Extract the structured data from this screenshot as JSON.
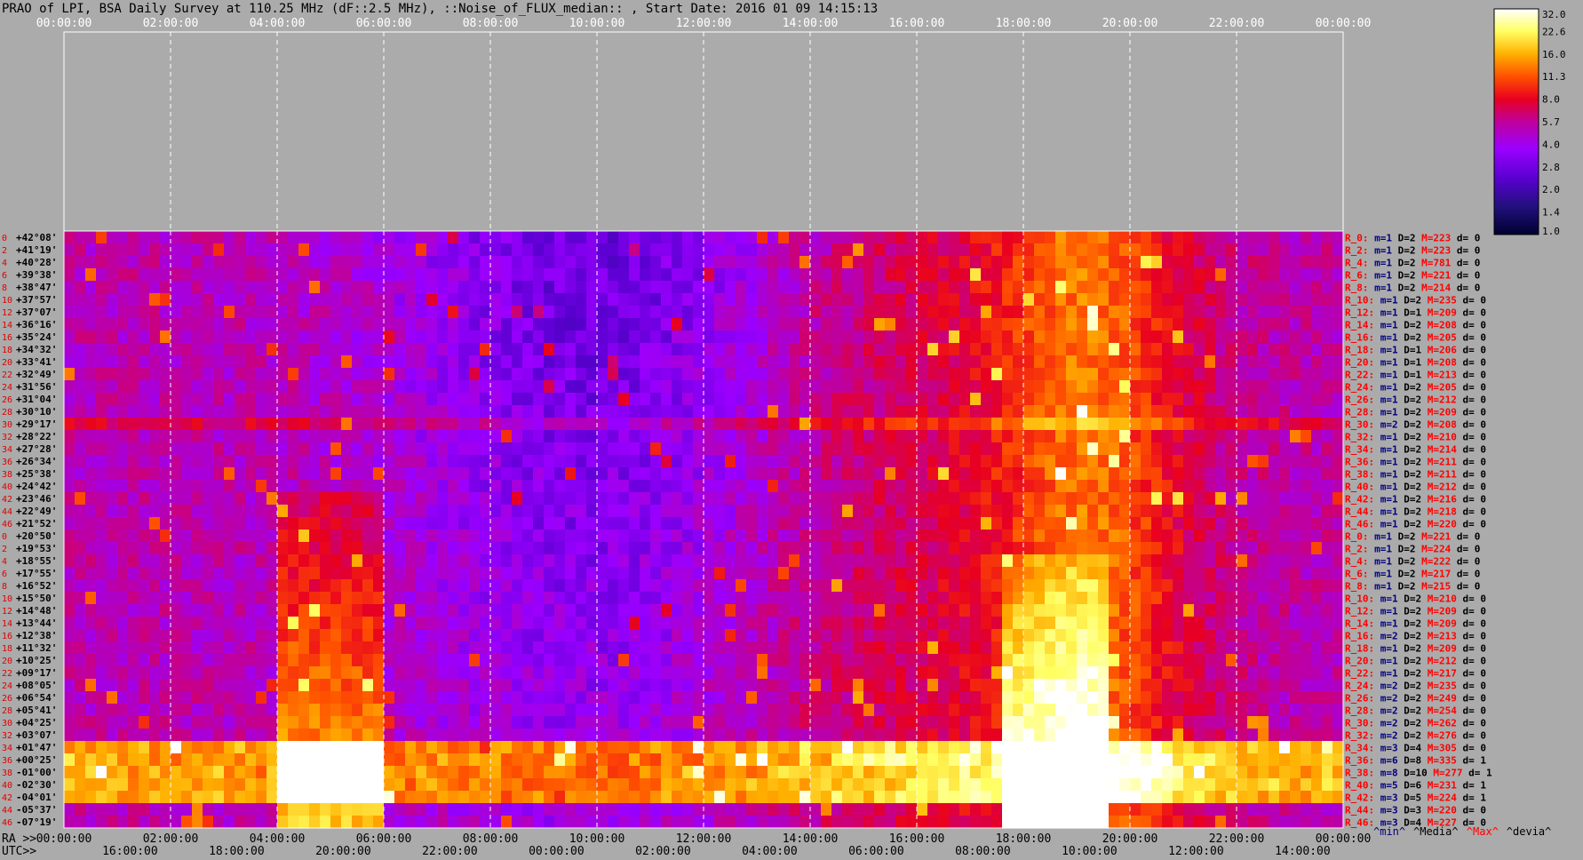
{
  "title": "PRAO of LPI, BSA Daily Survey at 110.25 MHz (dF::2.5 MHz), ::Noise_of_FLUX_median:: , Start Date: 2016 01 09 14:15:13",
  "chart_data": {
    "type": "heatmap",
    "title": "PRAO of LPI, BSA Daily Survey at 110.25 MHz (dF::2.5 MHz), ::Noise_of_FLUX_median:: , Start Date: 2016 01 09 14:15:13",
    "x_axis_top_ticks": [
      "00:00:00",
      "02:00:00",
      "04:00:00",
      "06:00:00",
      "08:00:00",
      "10:00:00",
      "12:00:00",
      "14:00:00",
      "16:00:00",
      "18:00:00",
      "20:00:00",
      "22:00:00",
      "00:00:00"
    ],
    "ra_axis_label": "RA >>",
    "ra_ticks": [
      "00:00:00",
      "02:00:00",
      "04:00:00",
      "06:00:00",
      "08:00:00",
      "10:00:00",
      "12:00:00",
      "14:00:00",
      "16:00:00",
      "18:00:00",
      "20:00:00",
      "22:00:00",
      "00:00:00"
    ],
    "utc_axis_label": "UTC>>",
    "utc_ticks": [
      "16:00:00",
      "18:00:00",
      "20:00:00",
      "22:00:00",
      "00:00:00",
      "02:00:00",
      "04:00:00",
      "06:00:00",
      "08:00:00",
      "10:00:00",
      "12:00:00",
      "14:00:00"
    ],
    "declination_labels": [
      "+42°08'",
      "+41°19'",
      "+40°28'",
      "+39°38'",
      "+38°47'",
      "+37°57'",
      "+37°07'",
      "+36°16'",
      "+35°24'",
      "+34°32'",
      "+33°41'",
      "+32°49'",
      "+31°56'",
      "+31°04'",
      "+30°10'",
      "+29°17'",
      "+28°22'",
      "+27°28'",
      "+26°34'",
      "+25°38'",
      "+24°42'",
      "+23°46'",
      "+22°49'",
      "+21°52'",
      "+20°50'",
      "+19°53'",
      "+18°55'",
      "+17°55'",
      "+16°52'",
      "+15°50'",
      "+14°48'",
      "+13°44'",
      "+12°38'",
      "+11°32'",
      "+10°25'",
      "+09°17'",
      "+08°05'",
      "+06°54'",
      "+05°41'",
      "+04°25'",
      "+03°07'",
      "+01°47'",
      "+00°25'",
      "-01°00'",
      "-02°30'",
      "-04°01'",
      "-05°37'",
      "-07°19'"
    ],
    "row_indices": [
      "0",
      "2",
      "4",
      "6",
      "8",
      "10",
      "12",
      "14",
      "16",
      "18",
      "20",
      "22",
      "24",
      "26",
      "28",
      "30",
      "32",
      "34",
      "36",
      "38",
      "40",
      "42",
      "44",
      "46",
      "0",
      "2",
      "4",
      "6",
      "8",
      "10",
      "12",
      "14",
      "16",
      "18",
      "20",
      "22",
      "24",
      "26",
      "28",
      "30",
      "32",
      "34",
      "36",
      "38",
      "40",
      "42",
      "44",
      "46"
    ],
    "colorbar": {
      "ticks": [
        "32.0",
        "22.6",
        "16.0",
        "11.3",
        "8.0",
        "5.7",
        "4.0",
        "2.8",
        "2.0",
        "1.4",
        "1.0"
      ],
      "scale": "log",
      "range": [
        1.0,
        32.0
      ],
      "colors": [
        "#ffffff",
        "#ffff60",
        "#ffb000",
        "#ff5000",
        "#e80020",
        "#c0009c",
        "#9a00ff",
        "#5a00d0",
        "#20107a",
        "#000030"
      ]
    },
    "row_stats": [
      {
        "r": "R_0:",
        "m": "m=1",
        "D": "D=2",
        "M": "M=223",
        "d": "d= 0"
      },
      {
        "r": "R_2:",
        "m": "m=1",
        "D": "D=2",
        "M": "M=223",
        "d": "d= 0"
      },
      {
        "r": "R_4:",
        "m": "m=1",
        "D": "D=2",
        "M": "M=781",
        "d": "d= 0"
      },
      {
        "r": "R_6:",
        "m": "m=1",
        "D": "D=2",
        "M": "M=221",
        "d": "d= 0"
      },
      {
        "r": "R_8:",
        "m": "m=1",
        "D": "D=2",
        "M": "M=214",
        "d": "d= 0"
      },
      {
        "r": "R_10:",
        "m": "m=1",
        "D": "D=2",
        "M": "M=235",
        "d": "d= 0"
      },
      {
        "r": "R_12:",
        "m": "m=1",
        "D": "D=1",
        "M": "M=209",
        "d": "d= 0"
      },
      {
        "r": "R_14:",
        "m": "m=1",
        "D": "D=2",
        "M": "M=208",
        "d": "d= 0"
      },
      {
        "r": "R_16:",
        "m": "m=1",
        "D": "D=2",
        "M": "M=205",
        "d": "d= 0"
      },
      {
        "r": "R_18:",
        "m": "m=1",
        "D": "D=1",
        "M": "M=206",
        "d": "d= 0"
      },
      {
        "r": "R_20:",
        "m": "m=1",
        "D": "D=1",
        "M": "M=208",
        "d": "d= 0"
      },
      {
        "r": "R_22:",
        "m": "m=1",
        "D": "D=1",
        "M": "M=213",
        "d": "d= 0"
      },
      {
        "r": "R_24:",
        "m": "m=1",
        "D": "D=2",
        "M": "M=205",
        "d": "d= 0"
      },
      {
        "r": "R_26:",
        "m": "m=1",
        "D": "D=2",
        "M": "M=212",
        "d": "d= 0"
      },
      {
        "r": "R_28:",
        "m": "m=1",
        "D": "D=2",
        "M": "M=209",
        "d": "d= 0"
      },
      {
        "r": "R_30:",
        "m": "m=2",
        "D": "D=2",
        "M": "M=208",
        "d": "d= 0"
      },
      {
        "r": "R_32:",
        "m": "m=1",
        "D": "D=2",
        "M": "M=210",
        "d": "d= 0"
      },
      {
        "r": "R_34:",
        "m": "m=1",
        "D": "D=2",
        "M": "M=214",
        "d": "d= 0"
      },
      {
        "r": "R_36:",
        "m": "m=1",
        "D": "D=2",
        "M": "M=211",
        "d": "d= 0"
      },
      {
        "r": "R_38:",
        "m": "m=1",
        "D": "D=2",
        "M": "M=211",
        "d": "d= 0"
      },
      {
        "r": "R_40:",
        "m": "m=1",
        "D": "D=2",
        "M": "M=212",
        "d": "d= 0"
      },
      {
        "r": "R_42:",
        "m": "m=1",
        "D": "D=2",
        "M": "M=216",
        "d": "d= 0"
      },
      {
        "r": "R_44:",
        "m": "m=1",
        "D": "D=2",
        "M": "M=218",
        "d": "d= 0"
      },
      {
        "r": "R_46:",
        "m": "m=1",
        "D": "D=2",
        "M": "M=220",
        "d": "d= 0"
      },
      {
        "r": "R_0:",
        "m": "m=1",
        "D": "D=2",
        "M": "M=221",
        "d": "d= 0"
      },
      {
        "r": "R_2:",
        "m": "m=1",
        "D": "D=2",
        "M": "M=224",
        "d": "d= 0"
      },
      {
        "r": "R_4:",
        "m": "m=1",
        "D": "D=2",
        "M": "M=222",
        "d": "d= 0"
      },
      {
        "r": "R_6:",
        "m": "m=1",
        "D": "D=2",
        "M": "M=217",
        "d": "d= 0"
      },
      {
        "r": "R_8:",
        "m": "m=1",
        "D": "D=2",
        "M": "M=215",
        "d": "d= 0"
      },
      {
        "r": "R_10:",
        "m": "m=1",
        "D": "D=2",
        "M": "M=210",
        "d": "d= 0"
      },
      {
        "r": "R_12:",
        "m": "m=1",
        "D": "D=2",
        "M": "M=209",
        "d": "d= 0"
      },
      {
        "r": "R_14:",
        "m": "m=1",
        "D": "D=2",
        "M": "M=209",
        "d": "d= 0"
      },
      {
        "r": "R_16:",
        "m": "m=2",
        "D": "D=2",
        "M": "M=213",
        "d": "d= 0"
      },
      {
        "r": "R_18:",
        "m": "m=1",
        "D": "D=2",
        "M": "M=209",
        "d": "d= 0"
      },
      {
        "r": "R_20:",
        "m": "m=1",
        "D": "D=2",
        "M": "M=212",
        "d": "d= 0"
      },
      {
        "r": "R_22:",
        "m": "m=1",
        "D": "D=2",
        "M": "M=217",
        "d": "d= 0"
      },
      {
        "r": "R_24:",
        "m": "m=2",
        "D": "D=2",
        "M": "M=235",
        "d": "d= 0"
      },
      {
        "r": "R_26:",
        "m": "m=2",
        "D": "D=2",
        "M": "M=249",
        "d": "d= 0"
      },
      {
        "r": "R_28:",
        "m": "m=2",
        "D": "D=2",
        "M": "M=254",
        "d": "d= 0"
      },
      {
        "r": "R_30:",
        "m": "m=2",
        "D": "D=2",
        "M": "M=262",
        "d": "d= 0"
      },
      {
        "r": "R_32:",
        "m": "m=2",
        "D": "D=2",
        "M": "M=276",
        "d": "d= 0"
      },
      {
        "r": "R_34:",
        "m": "m=3",
        "D": "D=4",
        "M": "M=305",
        "d": "d= 0"
      },
      {
        "r": "R_36:",
        "m": "m=6",
        "D": "D=8",
        "M": "M=335",
        "d": "d= 1"
      },
      {
        "r": "R_38:",
        "m": "m=8",
        "D": "D=10",
        "M": "M=277",
        "d": "d= 1"
      },
      {
        "r": "R_40:",
        "m": "m=5",
        "D": "D=6",
        "M": "M=231",
        "d": "d= 1"
      },
      {
        "r": "R_42:",
        "m": "m=3",
        "D": "D=5",
        "M": "M=224",
        "d": "d= 1"
      },
      {
        "r": "R_44:",
        "m": "m=3",
        "D": "D=3",
        "M": "M=220",
        "d": "d= 0"
      },
      {
        "r": "R_46:",
        "m": "m=3",
        "D": "D=4",
        "M": "M=227",
        "d": "d= 0"
      }
    ],
    "legend": [
      {
        "text": "^min^",
        "color": "#000080"
      },
      {
        "text": "^Media^",
        "color": "#000000"
      },
      {
        "text": "^Max^",
        "color": "#ff0000"
      },
      {
        "text": "^devia^",
        "color": "#000000"
      }
    ]
  }
}
